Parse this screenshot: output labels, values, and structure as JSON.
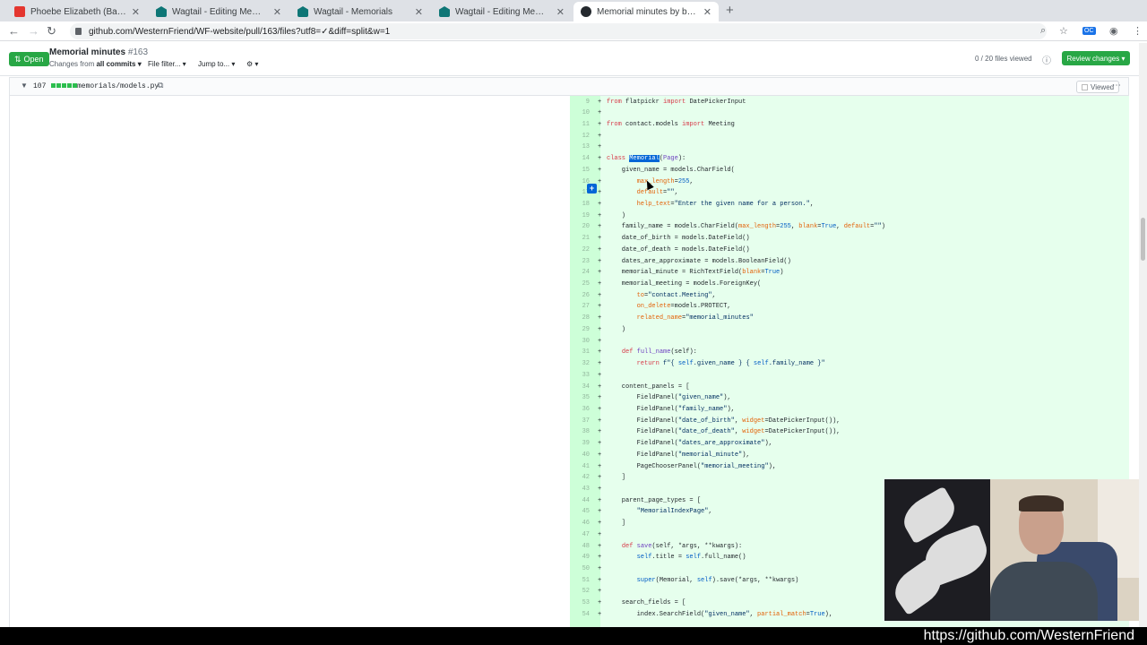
{
  "browser": {
    "tabs": [
      {
        "title": "Phoebe Elizabeth (Bashore) C",
        "icon": "pinterest-icon",
        "active": false
      },
      {
        "title": "Wagtail - Editing Memorial: Pl",
        "icon": "wagtail-icon",
        "active": false
      },
      {
        "title": "Wagtail - Memorials",
        "icon": "wagtail-icon",
        "active": false
      },
      {
        "title": "Wagtail - Editing Memorial: Pl",
        "icon": "wagtail-icon",
        "active": false
      },
      {
        "title": "Memorial minutes by brylie",
        "icon": "github-icon",
        "active": true
      }
    ],
    "url": "github.com/WesternFriend/WF-website/pull/163/files?utf8=✓&diff=split&w=1"
  },
  "pr": {
    "status": "Open",
    "title": "Memorial minutes",
    "number": "#163",
    "changes_from": "Changes from",
    "all_commits": "all commits ▾",
    "file_filter": "File filter... ▾",
    "jump_to": "Jump to... ▾",
    "settings": "⚙ ▾",
    "files_viewed": "0 / 20 files viewed",
    "review_button": "Review changes ▾"
  },
  "file": {
    "additions": "107",
    "name": "memorials/models.py",
    "viewed_label": "Viewed"
  },
  "code_lines": [
    {
      "n": "9",
      "html": "<span class='kw'>from</span> flatpickr <span class='kw'>import</span> DatePickerInput"
    },
    {
      "n": "10",
      "html": ""
    },
    {
      "n": "11",
      "html": "<span class='kw'>from</span> contact.models <span class='kw'>import</span> Meeting"
    },
    {
      "n": "12",
      "html": ""
    },
    {
      "n": "13",
      "html": ""
    },
    {
      "n": "14",
      "html": "<span class='kw'>class</span> <span class='sel'>Memorial</span>(<span class='fn'>Page</span>):"
    },
    {
      "n": "15",
      "html": "    given_name = models.CharField("
    },
    {
      "n": "16",
      "html": "        <span class='ar'>max_length</span>=<span class='nm'>255</span>,"
    },
    {
      "n": "17",
      "html": "        <span class='ar'>default</span>=<span class='st'>\"\"</span>,"
    },
    {
      "n": "18",
      "html": "        <span class='ar'>help_text</span>=<span class='st'>\"Enter the given name for a person.\"</span>,"
    },
    {
      "n": "19",
      "html": "    )"
    },
    {
      "n": "20",
      "html": "    family_name = models.CharField(<span class='ar'>max_length</span>=<span class='nm'>255</span>, <span class='ar'>blank</span>=<span class='nm'>True</span>, <span class='ar'>default</span>=<span class='st'>\"\"</span>)"
    },
    {
      "n": "21",
      "html": "    date_of_birth = models.DateField()"
    },
    {
      "n": "22",
      "html": "    date_of_death = models.DateField()"
    },
    {
      "n": "23",
      "html": "    dates_are_approximate = models.BooleanField()"
    },
    {
      "n": "24",
      "html": "    memorial_minute = RichTextField(<span class='ar'>blank</span>=<span class='nm'>True</span>)"
    },
    {
      "n": "25",
      "html": "    memorial_meeting = models.ForeignKey("
    },
    {
      "n": "26",
      "html": "        <span class='ar'>to</span>=<span class='st'>\"contact.Meeting\"</span>,"
    },
    {
      "n": "27",
      "html": "        <span class='ar'>on_delete</span>=models.PROTECT,"
    },
    {
      "n": "28",
      "html": "        <span class='ar'>related_name</span>=<span class='st'>\"memorial_minutes\"</span>"
    },
    {
      "n": "29",
      "html": "    )"
    },
    {
      "n": "30",
      "html": ""
    },
    {
      "n": "31",
      "html": "    <span class='kw'>def</span> <span class='fn'>full_name</span>(self):"
    },
    {
      "n": "32",
      "html": "        <span class='kw'>return</span> <span class='st'>f\"{ <span class='nm'>self</span>.given_name } { <span class='nm'>self</span>.family_name }\"</span>"
    },
    {
      "n": "33",
      "html": ""
    },
    {
      "n": "34",
      "html": "    content_panels = ["
    },
    {
      "n": "35",
      "html": "        FieldPanel(<span class='st'>\"given_name\"</span>),"
    },
    {
      "n": "36",
      "html": "        FieldPanel(<span class='st'>\"family_name\"</span>),"
    },
    {
      "n": "37",
      "html": "        FieldPanel(<span class='st'>\"date_of_birth\"</span>, <span class='ar'>widget</span>=DatePickerInput()),"
    },
    {
      "n": "38",
      "html": "        FieldPanel(<span class='st'>\"date_of_death\"</span>, <span class='ar'>widget</span>=DatePickerInput()),"
    },
    {
      "n": "39",
      "html": "        FieldPanel(<span class='st'>\"dates_are_approximate\"</span>),"
    },
    {
      "n": "40",
      "html": "        FieldPanel(<span class='st'>\"memorial_minute\"</span>),"
    },
    {
      "n": "41",
      "html": "        PageChooserPanel(<span class='st'>\"memorial_meeting\"</span>),"
    },
    {
      "n": "42",
      "html": "    ]"
    },
    {
      "n": "43",
      "html": ""
    },
    {
      "n": "44",
      "html": "    parent_page_types = ["
    },
    {
      "n": "45",
      "html": "        <span class='st'>\"MemorialIndexPage\"</span>,"
    },
    {
      "n": "46",
      "html": "    ]"
    },
    {
      "n": "47",
      "html": ""
    },
    {
      "n": "48",
      "html": "    <span class='kw'>def</span> <span class='fn'>save</span>(self, *args, **kwargs):"
    },
    {
      "n": "49",
      "html": "        <span class='nm'>self</span>.title = <span class='nm'>self</span>.full_name()"
    },
    {
      "n": "50",
      "html": ""
    },
    {
      "n": "51",
      "html": "        <span class='nm'>super</span>(Memorial, <span class='nm'>self</span>).save(*args, **kwargs)"
    },
    {
      "n": "52",
      "html": ""
    },
    {
      "n": "53",
      "html": "    search_fields = ["
    },
    {
      "n": "54",
      "html": "        index.SearchField(<span class='st'>\"given_name\"</span>, <span class='ar'>partial_match</span>=<span class='nm'>True</span>),"
    }
  ],
  "watermark": "https://github.com/WesternFriend",
  "colors": {
    "open_green": "#28a745",
    "addition_bg": "#e6ffed",
    "addition_gutter": "#cdffd8",
    "selection": "#0366d6"
  }
}
